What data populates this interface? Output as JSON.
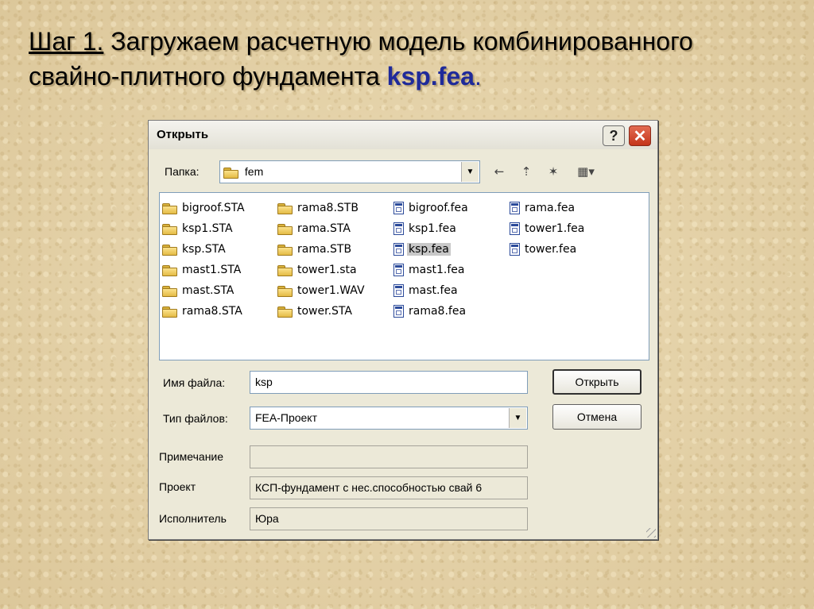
{
  "slide": {
    "step": "Шаг 1.",
    "title_line1": " Загружаем расчетную модель комбинированного",
    "title_line2": "свайно-плитного фундамента ",
    "filename": "ksp.fea",
    "dot": "."
  },
  "dialog": {
    "title": "Открыть",
    "help_label": "?",
    "close_label": "✕",
    "folder_label": "Папка:",
    "folder_value": "fem",
    "toolbar": {
      "back_icon": "←",
      "up_icon": "⇡",
      "new_folder_icon": "✶",
      "view_icon": "▦▾"
    },
    "files": {
      "columns": [
        [
          {
            "name": "bigroof.STA",
            "icon": "folder"
          },
          {
            "name": "ksp1.STA",
            "icon": "folder"
          },
          {
            "name": "ksp.STA",
            "icon": "folder"
          },
          {
            "name": "mast1.STA",
            "icon": "folder"
          },
          {
            "name": "mast.STA",
            "icon": "folder"
          },
          {
            "name": "rama8.STA",
            "icon": "folder"
          }
        ],
        [
          {
            "name": "rama8.STB",
            "icon": "folder"
          },
          {
            "name": "rama.STA",
            "icon": "folder"
          },
          {
            "name": "rama.STB",
            "icon": "folder"
          },
          {
            "name": "tower1.sta",
            "icon": "folder"
          },
          {
            "name": "tower1.WAV",
            "icon": "folder"
          },
          {
            "name": "tower.STA",
            "icon": "folder"
          }
        ],
        [
          {
            "name": "bigroof.fea",
            "icon": "file"
          },
          {
            "name": "ksp1.fea",
            "icon": "file"
          },
          {
            "name": "ksp.fea",
            "icon": "file",
            "selected": true
          },
          {
            "name": "mast1.fea",
            "icon": "file"
          },
          {
            "name": "mast.fea",
            "icon": "file"
          },
          {
            "name": "rama8.fea",
            "icon": "file"
          }
        ],
        [
          {
            "name": "rama.fea",
            "icon": "file"
          },
          {
            "name": "tower1.fea",
            "icon": "file"
          },
          {
            "name": "tower.fea",
            "icon": "file"
          }
        ]
      ]
    },
    "filename_label": "Имя файла:",
    "filename_value": "ksp",
    "filetype_label": "Тип файлов:",
    "filetype_value": "FEA-Проект",
    "note_label": "Примечание",
    "note_value": "",
    "project_label": "Проект",
    "project_value": "КСП-фундамент с нес.способностью свай 6",
    "author_label": "Исполнитель",
    "author_value": "Юра",
    "open_button": "Открыть",
    "cancel_button": "Отмена"
  }
}
